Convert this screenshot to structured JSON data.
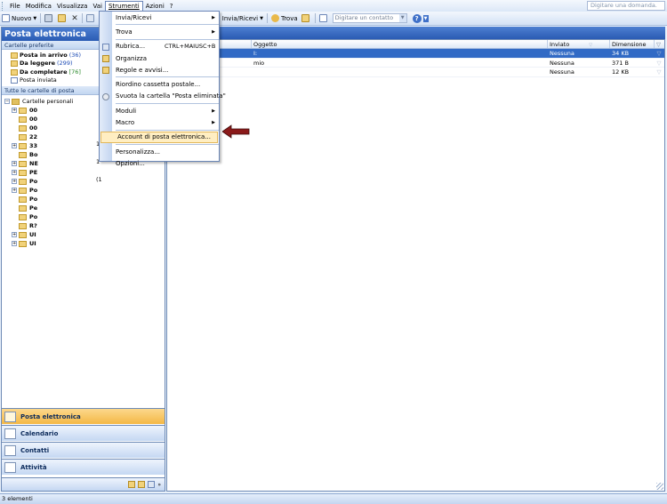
{
  "menubar": {
    "items": [
      "File",
      "Modifica",
      "Visualizza",
      "Vai",
      "Strumenti",
      "Azioni",
      "?"
    ],
    "help_placeholder": "Digitare una domanda."
  },
  "toolbar": {
    "new_label": "Nuovo",
    "send_receive_label": "Invia/Ricevi",
    "find_label": "Trova",
    "contact_placeholder": "Digitare un contatto"
  },
  "nav": {
    "title": "Posta elettronica",
    "favorites_label": "Cartelle preferite",
    "favorites": [
      {
        "name": "Posta in arrivo",
        "count": "(36)"
      },
      {
        "name": "Da leggere",
        "count": "(299)"
      },
      {
        "name": "Da completare",
        "count": "[76]"
      },
      {
        "name": "Posta inviata",
        "count": ""
      }
    ],
    "all_folders_label": "Tutte le cartelle di posta",
    "personal_folders_label": "Cartelle personali",
    "tree": [
      "00",
      "00",
      "00",
      "22",
      "33",
      "Bo",
      "NE",
      "PE",
      "Po",
      "Po",
      "Po",
      "Pe",
      "Po",
      "R?",
      "UI",
      "UI"
    ],
    "side_digits": [
      "1",
      "1",
      "(1"
    ],
    "buttons": [
      "Posta elettronica",
      "Calendario",
      "Contatti",
      "Attività"
    ]
  },
  "dropdown": {
    "items": [
      {
        "label": "Invia/Ricevi",
        "submenu": true
      },
      {
        "label": "Trova",
        "submenu": true
      },
      {
        "label": "Rubrica...",
        "shortcut": "CTRL+MAIUSC+B"
      },
      {
        "label": "Organizza"
      },
      {
        "label": "Regole e avvisi..."
      },
      {
        "label": "Riordino cassetta postale..."
      },
      {
        "label": "Svuota la cartella \"Posta eliminata\""
      },
      {
        "label": "Moduli",
        "submenu": true
      },
      {
        "label": "Macro",
        "submenu": true
      },
      {
        "label": "Account di posta elettronica..."
      },
      {
        "label": "Personalizza..."
      },
      {
        "label": "Opzioni..."
      }
    ]
  },
  "list": {
    "columns": [
      "Oggetto",
      "Inviato",
      "Dimensione"
    ],
    "rows": [
      {
        "subject": "I:",
        "sent": "Nessuna",
        "size": "34 KB"
      },
      {
        "subject": "mio",
        "sent": "Nessuna",
        "size": "371 B"
      },
      {
        "subject": "",
        "sent": "Nessuna",
        "size": "12 KB"
      }
    ]
  },
  "status": {
    "text": "3 elementi"
  },
  "colors": {
    "accent": "#2a5bb3",
    "selection": "#316ac5",
    "arrow": "#8b1a1a",
    "active_nav": "#f4b745"
  }
}
